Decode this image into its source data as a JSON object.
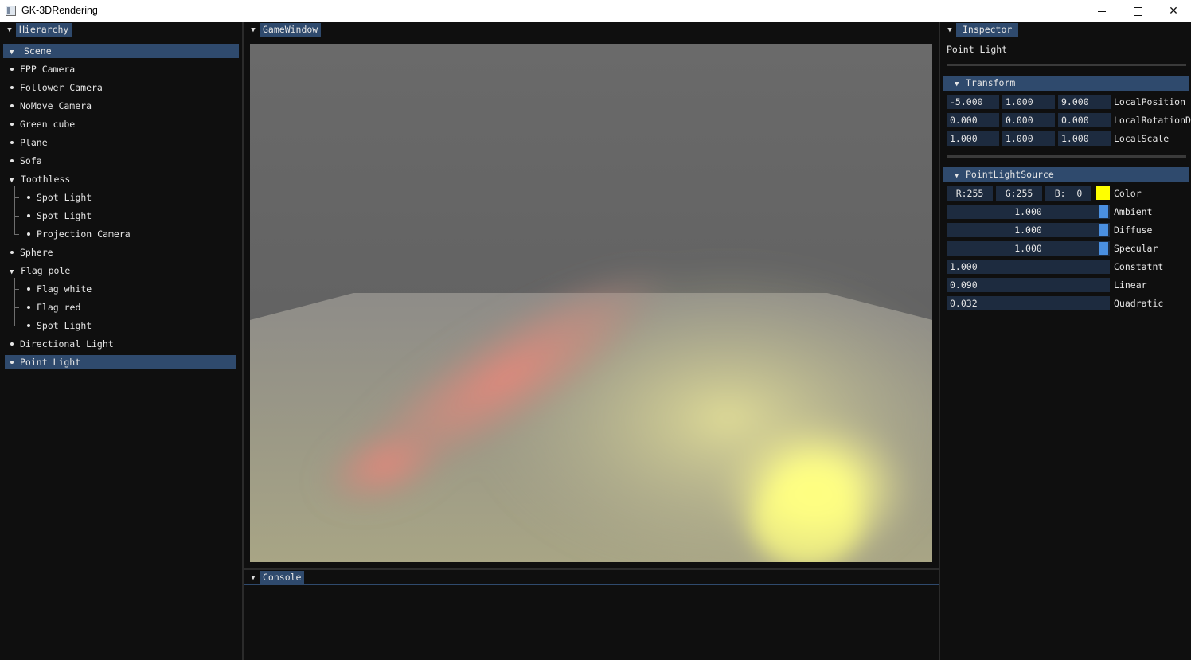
{
  "window": {
    "title": "GK-3DRendering",
    "minimize_icon": "minimize-icon",
    "maximize_icon": "maximize-icon",
    "close_glyph": "✕"
  },
  "hierarchy": {
    "tab_label": "Hierarchy",
    "scene_label": "Scene",
    "items": [
      "FPP Camera",
      "Follower Camera",
      "NoMove Camera",
      "Green cube",
      "Plane",
      "Sofa",
      "Toothless",
      "Spot Light",
      "Spot Light",
      "Projection Camera",
      "Sphere",
      "Flag pole",
      "Flag white",
      "Flag red",
      "Spot Light",
      "Directional Light",
      "Point Light"
    ],
    "selected": "Point Light"
  },
  "game_window": {
    "tab_label": "GameWindow"
  },
  "console": {
    "tab_label": "Console"
  },
  "inspector": {
    "tab_label": "Inspector",
    "object_name": "Point Light",
    "transform": {
      "header": "Transform",
      "position": {
        "label": "LocalPosition",
        "x": "-5.000",
        "y": "1.000",
        "z": "9.000"
      },
      "rotation": {
        "label": "LocalRotationD",
        "x": "0.000",
        "y": "0.000",
        "z": "0.000"
      },
      "scale": {
        "label": "LocalScale",
        "x": "1.000",
        "y": "1.000",
        "z": "1.000"
      }
    },
    "point_light": {
      "header": "PointLightSource",
      "color": {
        "label": "Color",
        "r": "R:255",
        "g": "G:255",
        "b": "B:  0",
        "swatch": "#ffff00"
      },
      "ambient": {
        "label": "Ambient",
        "value": "1.000"
      },
      "diffuse": {
        "label": "Diffuse",
        "value": "1.000"
      },
      "specular": {
        "label": "Specular",
        "value": "1.000"
      },
      "constant": {
        "label": "Constatnt",
        "value": "1.000"
      },
      "linear": {
        "label": "Linear",
        "value": "0.090"
      },
      "quadratic": {
        "label": "Quadratic",
        "value": "0.032"
      }
    }
  },
  "colors": {
    "accent": "#2f4a6d",
    "field_bg": "#1d2b3f",
    "slider_grab": "#4a8fe0",
    "background": "#0f0f0f"
  }
}
